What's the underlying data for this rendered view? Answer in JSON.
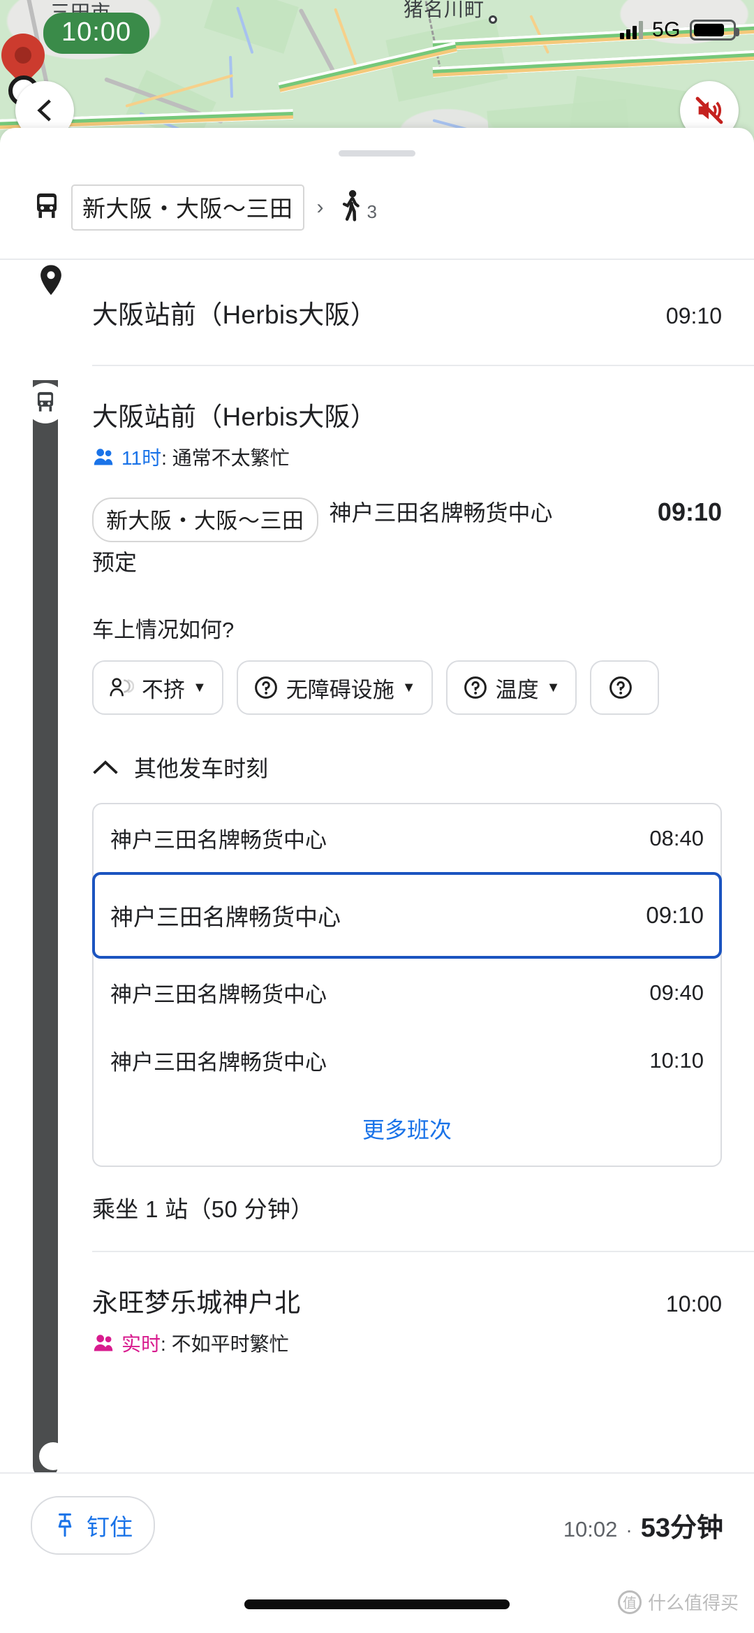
{
  "status_bar": {
    "network": "5G",
    "battery_level": 72
  },
  "map": {
    "time_pill": "10:00",
    "labels": [
      "三田市",
      "猪名川町"
    ],
    "back_icon": "back-arrow-icon",
    "mute_icon": "volume-muted-icon"
  },
  "route_header": {
    "transit_icon": "bus-icon",
    "line_name": "新大阪・大阪〜三田",
    "separator": "›",
    "walk_icon": "walking-person-icon",
    "walk_minutes": "3"
  },
  "origin": {
    "icon": "location-pin-icon",
    "name": "大阪站前（Herbis大阪）",
    "time": "09:10"
  },
  "board": {
    "icon": "bus-stop-icon",
    "name": "大阪站前（Herbis大阪）",
    "busy_icon": "people-icon",
    "busy_key": "11时",
    "busy_sep": ": ",
    "busy_text": "通常不太繁忙",
    "line_chip": "新大阪・大阪〜三田",
    "destination": "神户三田名牌畅货中心",
    "scheduled_label": "预定",
    "time": "09:10"
  },
  "feedback": {
    "question": "车上情况如何?",
    "chips": [
      {
        "icon": "crowding-icon",
        "label": "不挤",
        "caret": "▼"
      },
      {
        "icon": "question-circle-icon",
        "label": "无障碍设施",
        "caret": "▼"
      },
      {
        "icon": "question-circle-icon",
        "label": "温度",
        "caret": "▼"
      },
      {
        "icon": "question-circle-icon",
        "label": "",
        "caret": ""
      }
    ]
  },
  "other_departures": {
    "expander_icon": "chevron-up-icon",
    "expander_label": "其他发车时刻",
    "rows": [
      {
        "destination": "神户三田名牌畅货中心",
        "time": "08:40",
        "selected": false
      },
      {
        "destination": "神户三田名牌畅货中心",
        "time": "09:10",
        "selected": true
      },
      {
        "destination": "神户三田名牌畅货中心",
        "time": "09:40",
        "selected": false
      },
      {
        "destination": "神户三田名牌畅货中心",
        "time": "10:10",
        "selected": false
      }
    ],
    "more_label": "更多班次",
    "selected_border_color": "#1b54c0",
    "link_color": "#1a73e8"
  },
  "ride_summary": "乘坐 1 站（50 分钟）",
  "arrival": {
    "name": "永旺梦乐城神户北",
    "time": "10:00",
    "busy_icon": "people-icon",
    "busy_key": "实时",
    "busy_sep": ": ",
    "busy_text": "不如平时繁忙",
    "live_color": "#d81b8e"
  },
  "bottom_bar": {
    "pin_icon": "pushpin-icon",
    "pin_label": "钉住",
    "eta_time": "10:02",
    "eta_sep": "·",
    "eta_duration": "53分钟"
  },
  "watermark": {
    "badge": "值",
    "text": "什么值得买"
  }
}
